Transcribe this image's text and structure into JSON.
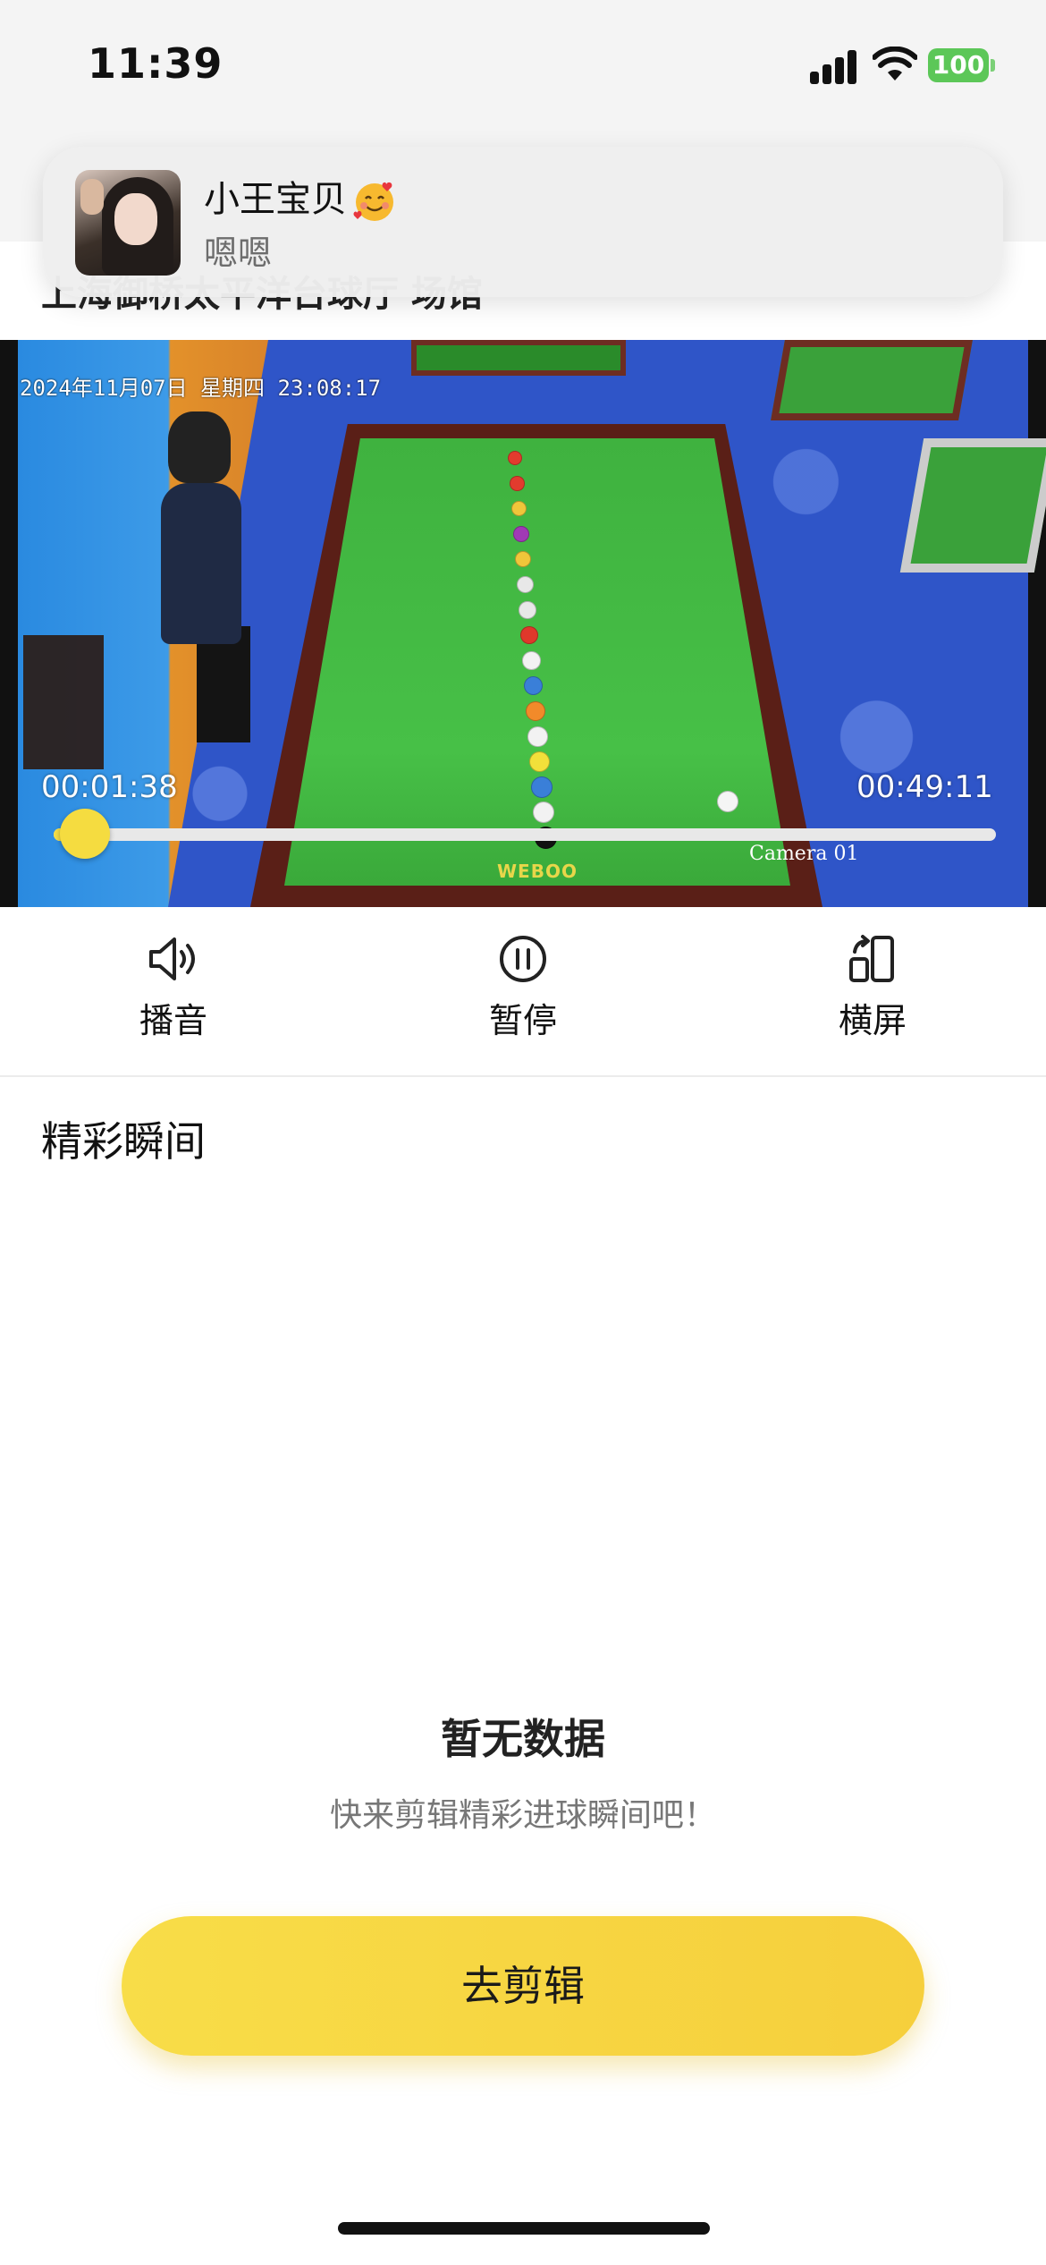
{
  "status_bar": {
    "time": "11:39",
    "battery": "100",
    "battery_color": "#5cc758"
  },
  "notification": {
    "sender": "小王宝贝",
    "emoji_icon": "smiling-face-with-hearts-icon",
    "message": "嗯嗯"
  },
  "header": {
    "title": "上海御桥太平洋台球厅 场馆"
  },
  "video": {
    "osd_datetime": "2024年11月07日 星期四 23:08:17",
    "camera_label": "Camera 01",
    "table_brand": "WEBOO",
    "current_time": "00:01:38",
    "total_time": "00:49:11",
    "progress_fraction": 0.033,
    "accent_color": "#f5dc40"
  },
  "controls": [
    {
      "label": "播音",
      "icon": "speaker-icon"
    },
    {
      "label": "暂停",
      "icon": "pause-icon"
    },
    {
      "label": "横屏",
      "icon": "rotate-screen-icon"
    }
  ],
  "highlights": {
    "title": "精彩瞬间",
    "empty_title": "暂无数据",
    "empty_subtitle": "快来剪辑精彩进球瞬间吧！",
    "cta_label": "去剪辑",
    "cta_color": "#f8dd48"
  }
}
